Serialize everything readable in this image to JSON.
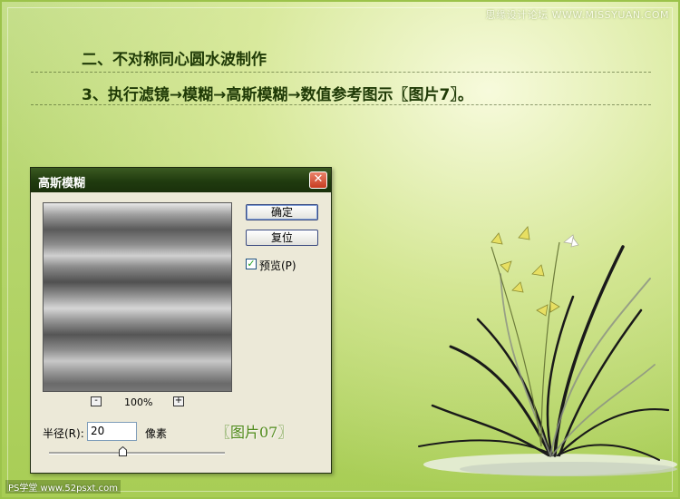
{
  "watermark": "思缘设计论坛  WWW.MISSYUAN.COM",
  "heading": {
    "section_title": "二、不对称同心圆水波制作",
    "step_text": "3、执行滤镜→模糊→高斯模糊→数值参考图示〖图片7〗。"
  },
  "dialog": {
    "title": "高斯模糊",
    "close_glyph": "✕",
    "ok_label": "确定",
    "reset_label": "复位",
    "preview_label": "预览(P)",
    "preview_checked": true,
    "zoom_minus": "-",
    "zoom_plus": "+",
    "zoom_level": "100%",
    "radius_label": "半径(R):",
    "radius_value": "20",
    "radius_unit": "像素",
    "slider_fraction": 0.42
  },
  "caption": "〖图片07〗",
  "logo_bottom": "PS学堂 www.52psxt.com",
  "colors": {
    "heading_text": "#1f3a06",
    "titlebar": "#203b0f",
    "caption": "#4f8a1a"
  },
  "icons": {
    "close": "close-icon",
    "checkbox": "check-icon",
    "slider": "slider-thumb-icon"
  }
}
